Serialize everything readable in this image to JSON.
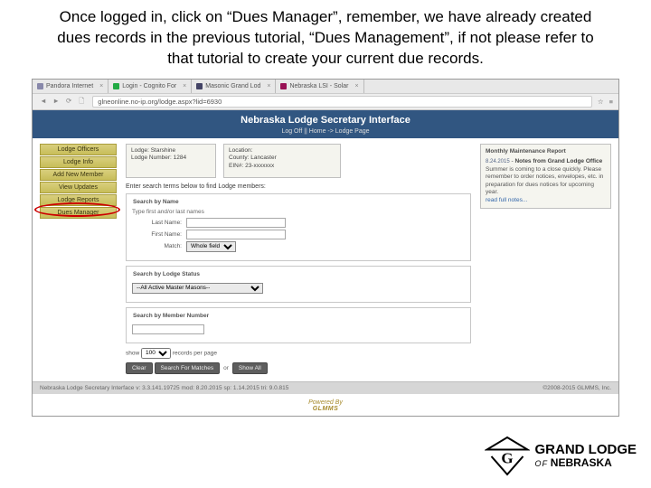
{
  "slide": {
    "title": "Once logged in, click on “Dues Manager”, remember, we have already created dues records in the previous tutorial, “Dues Management”, if not please refer to that tutorial to create your current due records."
  },
  "browser": {
    "tabs": [
      {
        "label": "Pandora Internet"
      },
      {
        "label": "Login - Cognito For"
      },
      {
        "label": "Masonic Grand Lod"
      },
      {
        "label": "Nebraska LSI - Solar"
      }
    ],
    "url": "glneonline.no-ip.org/lodge.aspx?lid=6930"
  },
  "banner": {
    "title": "Nebraska Lodge Secretary Interface",
    "subnav": "Log Off  ||  Home -> Lodge Page"
  },
  "sidebar": {
    "items": [
      "Lodge Officers",
      "Lodge Info",
      "Add New Member",
      "View Updates",
      "Lodge Reports",
      "Dues Manager"
    ]
  },
  "lodgeInfo": {
    "lodge_label": "Lodge:",
    "lodge_value": "Starshine",
    "number_label": "Lodge Number:",
    "number_value": "1284",
    "location_label": "Location:",
    "county_label": "County:",
    "county_value": "Lancaster",
    "ein_label": "EIN#:",
    "ein_value": "23-xxxxxxx"
  },
  "search": {
    "intro": "Enter search terms below to find Lodge members:",
    "byname_legend": "Search by Name",
    "hint": "Type first and/or last names",
    "lastname_label": "Last Name:",
    "firstname_label": "First Name:",
    "match_label": "Match:",
    "match_value": "Whole field",
    "status_legend": "Search by Lodge Status",
    "status_value": "--All Active Master Masons--",
    "member_legend": "Search by Member Number",
    "pager_prefix": "show",
    "pager_value": "100",
    "pager_suffix": "records per page",
    "btn_clear": "Clear",
    "btn_search": "Search For Matches",
    "btn_or": "or",
    "btn_showall": "Show All"
  },
  "report": {
    "header": "Monthly Maintenance Report",
    "date": "8.24.2015",
    "notes_title": "Notes from Grand Lodge Office",
    "body": "Summer is coming to a close quickly. Please remember to order notices, envelopes, etc. in preparation for dues notices for upcoming year.",
    "link": "read full notes..."
  },
  "footer": {
    "left": "Nebraska Lodge Secretary Interface     v: 3.3.141.19725   mod: 8.20.2015   sp: 1.14.2015   tri: 9.0.815",
    "right": "©2008-2015 GLMMS, Inc."
  },
  "powered": {
    "line1": "Powered By",
    "line2": "GLMMS"
  },
  "brand": {
    "l1": "GRAND LODGE",
    "l2": "OF",
    "l3": "NEBRASKA"
  }
}
